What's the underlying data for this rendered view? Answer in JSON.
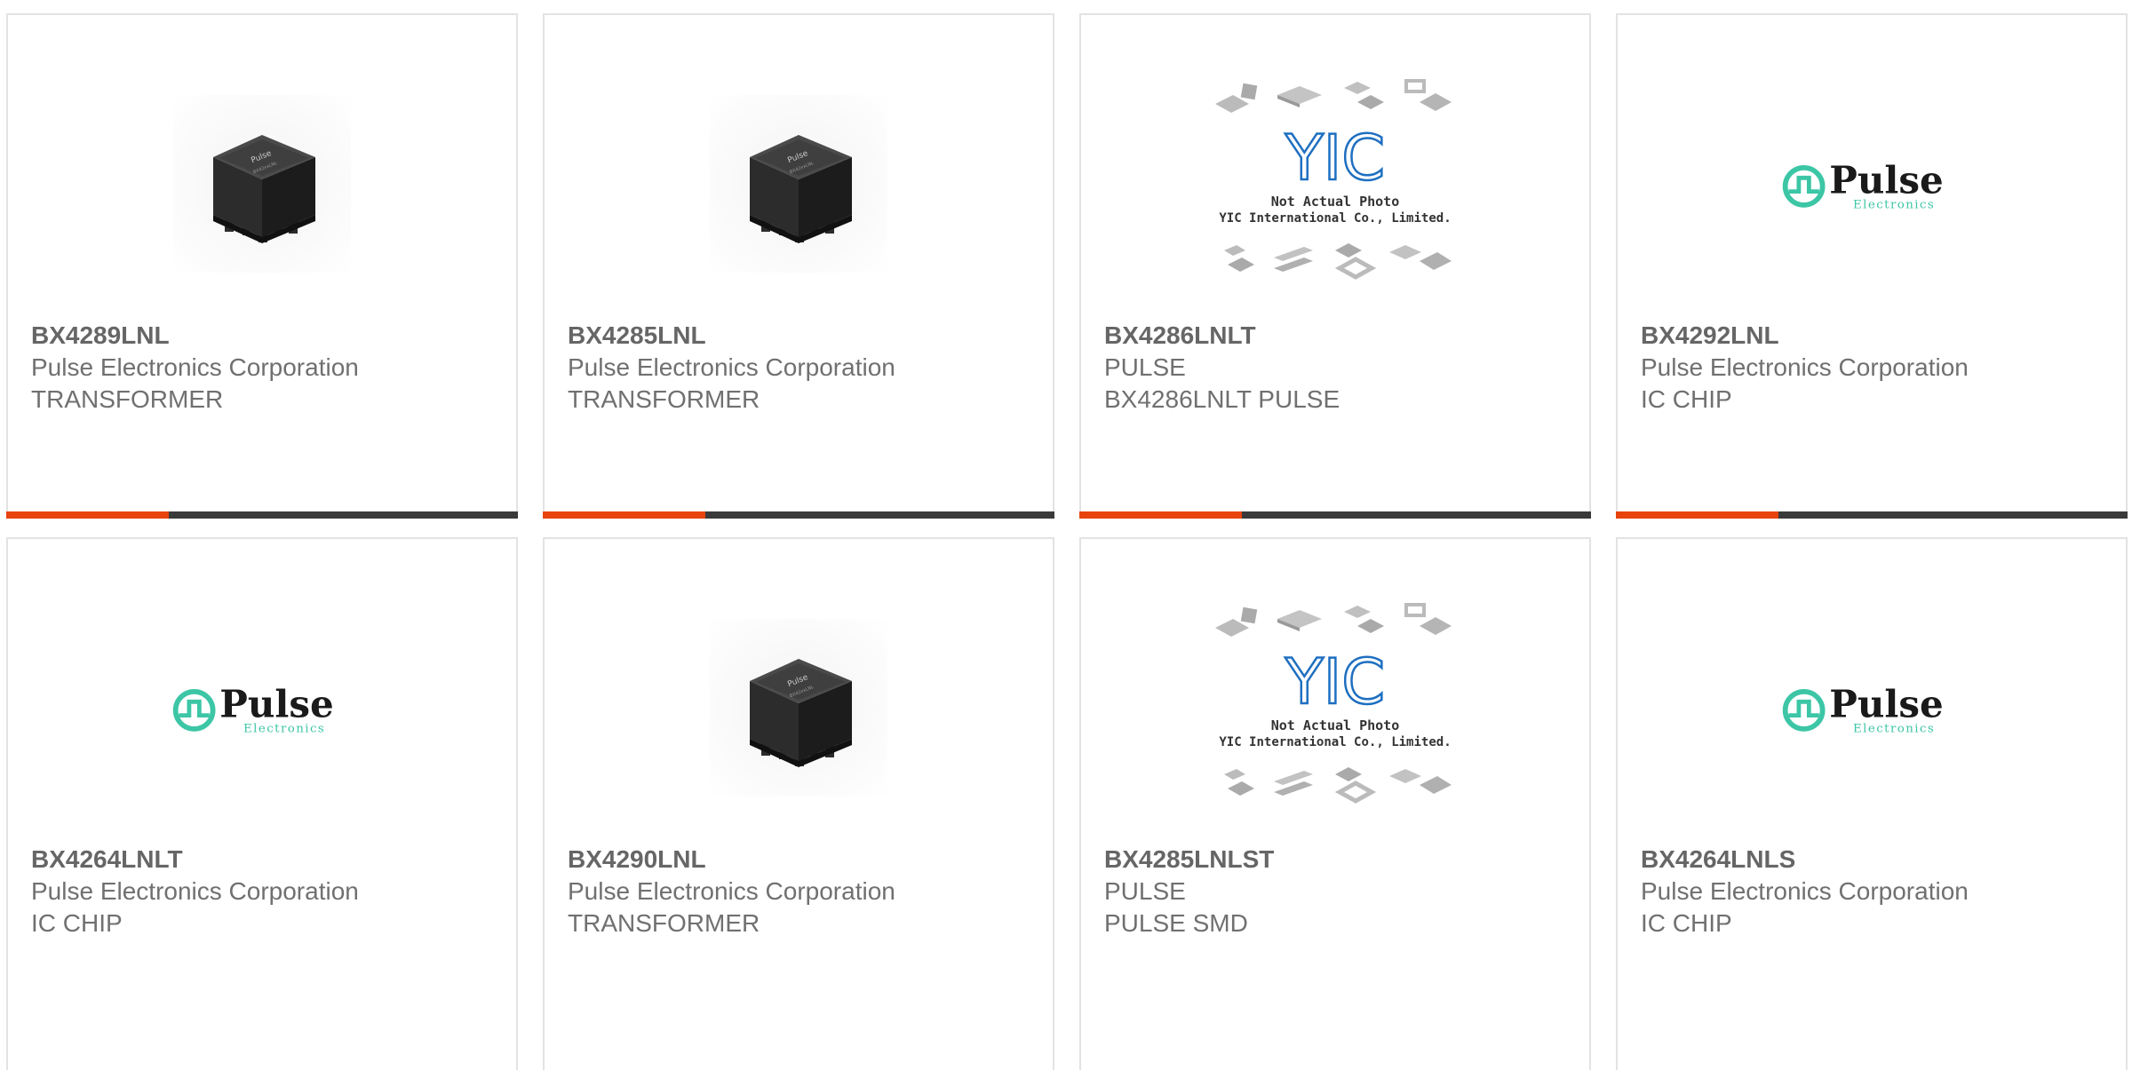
{
  "colors": {
    "accent": "#e8430f",
    "bar": "#3a3a3a",
    "pulse_green": "#3cc6a6"
  },
  "cards": [
    {
      "part": "BX4289LNL",
      "maker": "Pulse Electronics Corporation",
      "desc": "TRANSFORMER",
      "image": "transformer-photo"
    },
    {
      "part": "BX4285LNL",
      "maker": "Pulse Electronics Corporation",
      "desc": "TRANSFORMER",
      "image": "transformer-photo"
    },
    {
      "part": "BX4286LNLT",
      "maker": "PULSE",
      "desc": "BX4286LNLT PULSE",
      "image": "yic-placeholder",
      "placeholder": {
        "line1": "Not Actual Photo",
        "line2": "YIC International Co., Limited.",
        "logo": "YIC"
      }
    },
    {
      "part": "BX4292LNL",
      "maker": "Pulse Electronics Corporation",
      "desc": "IC CHIP",
      "image": "pulse-logo",
      "logo": {
        "word": "Pulse",
        "sub": "Electronics"
      }
    },
    {
      "part": "BX4264LNLT",
      "maker": "Pulse Electronics Corporation",
      "desc": "IC CHIP",
      "image": "pulse-logo",
      "logo": {
        "word": "Pulse",
        "sub": "Electronics"
      }
    },
    {
      "part": "BX4290LNL",
      "maker": "Pulse Electronics Corporation",
      "desc": "TRANSFORMER",
      "image": "transformer-photo"
    },
    {
      "part": "BX4285LNLST",
      "maker": "PULSE",
      "desc": "PULSE SMD",
      "image": "yic-placeholder",
      "placeholder": {
        "line1": "Not Actual Photo",
        "line2": "YIC International Co., Limited.",
        "logo": "YIC"
      }
    },
    {
      "part": "BX4264LNLS",
      "maker": "Pulse Electronics Corporation",
      "desc": "IC CHIP",
      "image": "pulse-logo",
      "logo": {
        "word": "Pulse",
        "sub": "Electronics"
      }
    }
  ]
}
